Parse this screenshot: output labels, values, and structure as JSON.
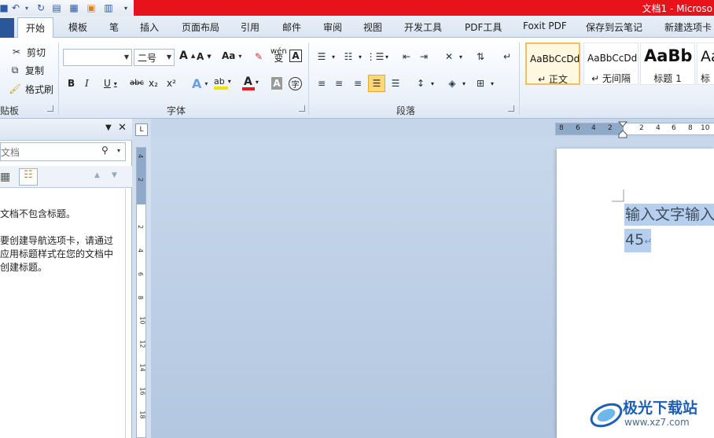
{
  "window": {
    "title": "文档1 - Microso"
  },
  "quick_access": [
    "save-icon",
    "undo-icon",
    "redo-icon",
    "print-preview-icon",
    "spell-icon",
    "new-icon",
    "open-icon",
    "more-icon"
  ],
  "tabs": [
    {
      "label": "开始",
      "active": true
    },
    {
      "label": "模板"
    },
    {
      "label": "笔"
    },
    {
      "label": "插入"
    },
    {
      "label": "页面布局"
    },
    {
      "label": "引用"
    },
    {
      "label": "邮件"
    },
    {
      "label": "审阅"
    },
    {
      "label": "视图"
    },
    {
      "label": "开发工具"
    },
    {
      "label": "PDF工具"
    },
    {
      "label": "Foxit PDF"
    },
    {
      "label": "保存到云笔记"
    },
    {
      "label": "新建选项卡"
    }
  ],
  "clipboard": {
    "cut": "剪切",
    "copy": "复制",
    "format_painter": "格式刷",
    "label": "贴板"
  },
  "font": {
    "name_value": "",
    "size_value": "二号",
    "label": "字体",
    "change_case": "Aa",
    "bold": "B",
    "italic": "I",
    "underline": "U",
    "strikethrough": "abc",
    "subscript": "x₂",
    "superscript": "x²",
    "grow": "A",
    "shrink": "A",
    "phonetic": "wén",
    "char_border": "A",
    "text_effect": "A",
    "highlight": "ab",
    "font_color": "A",
    "char_shading": "A",
    "enclose": "字",
    "colors": {
      "highlight": "#f3e300",
      "font_color": "#e31b23"
    }
  },
  "paragraph": {
    "label": "段落"
  },
  "styles": [
    {
      "sample": "AaBbCcDd",
      "name": "↵ 正文",
      "selected": true
    },
    {
      "sample": "AaBbCcDd",
      "name": "↵ 无间隔"
    },
    {
      "sample": "AaBb",
      "name": "标题 1"
    },
    {
      "sample": "Aa",
      "name": "标"
    }
  ],
  "nav_pane": {
    "search_placeholder": "文档",
    "messages": [
      "文档不包含标题。",
      "要创建导航选项卡，请通过",
      "应用标题样式在您的文档中",
      "创建标题。"
    ]
  },
  "ruler": {
    "corner": "L",
    "h_ticks": [
      "8",
      "6",
      "4",
      "2",
      "2",
      "4",
      "6",
      "8",
      "10"
    ],
    "v_ticks": [
      "4",
      "2",
      "2",
      "4",
      "6",
      "8",
      "10",
      "12",
      "14",
      "16",
      "18"
    ]
  },
  "document": {
    "line1": "输入文字输入",
    "line2": "45",
    "para_mark": "↵"
  },
  "watermark": {
    "name": "极光下载站",
    "url": "www.xz7.com"
  }
}
